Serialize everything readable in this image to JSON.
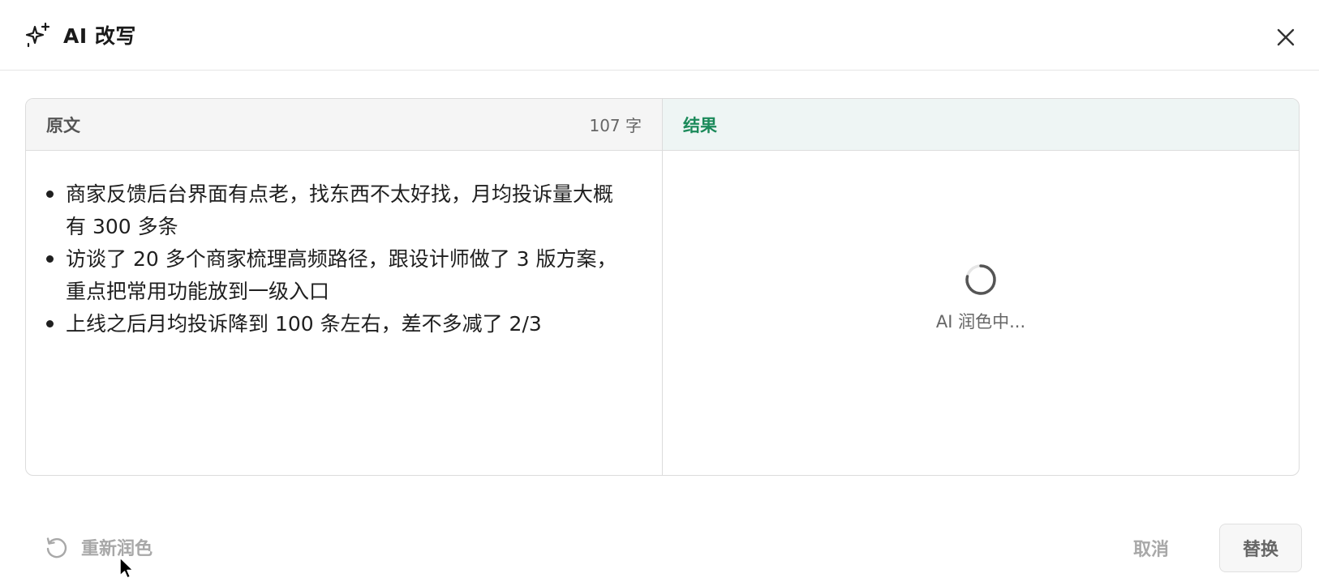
{
  "dialog": {
    "title": "AI 改写",
    "icons": {
      "title": "sparkle-icon",
      "close": "close-icon"
    }
  },
  "source_panel": {
    "label": "原文",
    "char_count": "107 字",
    "items": [
      "商家反馈后台界面有点老，找东西不太好找，月均投诉量大概有 300 多条",
      "访谈了 20 多个商家梳理高频路径，跟设计师做了 3 版方案，重点把常用功能放到一级入口",
      "上线之后月均投诉降到 100 条左右，差不多减了 2/3"
    ]
  },
  "result_panel": {
    "label": "结果",
    "loading_text": "AI 润色中..."
  },
  "footer": {
    "retry_label": "重新润色",
    "cancel_label": "取消",
    "replace_label": "替换"
  },
  "colors": {
    "accent_green": "#1b8a5a",
    "result_header_bg": "#eef5f4",
    "source_header_bg": "#f5f5f5",
    "disabled_text": "#a8a8a8"
  }
}
